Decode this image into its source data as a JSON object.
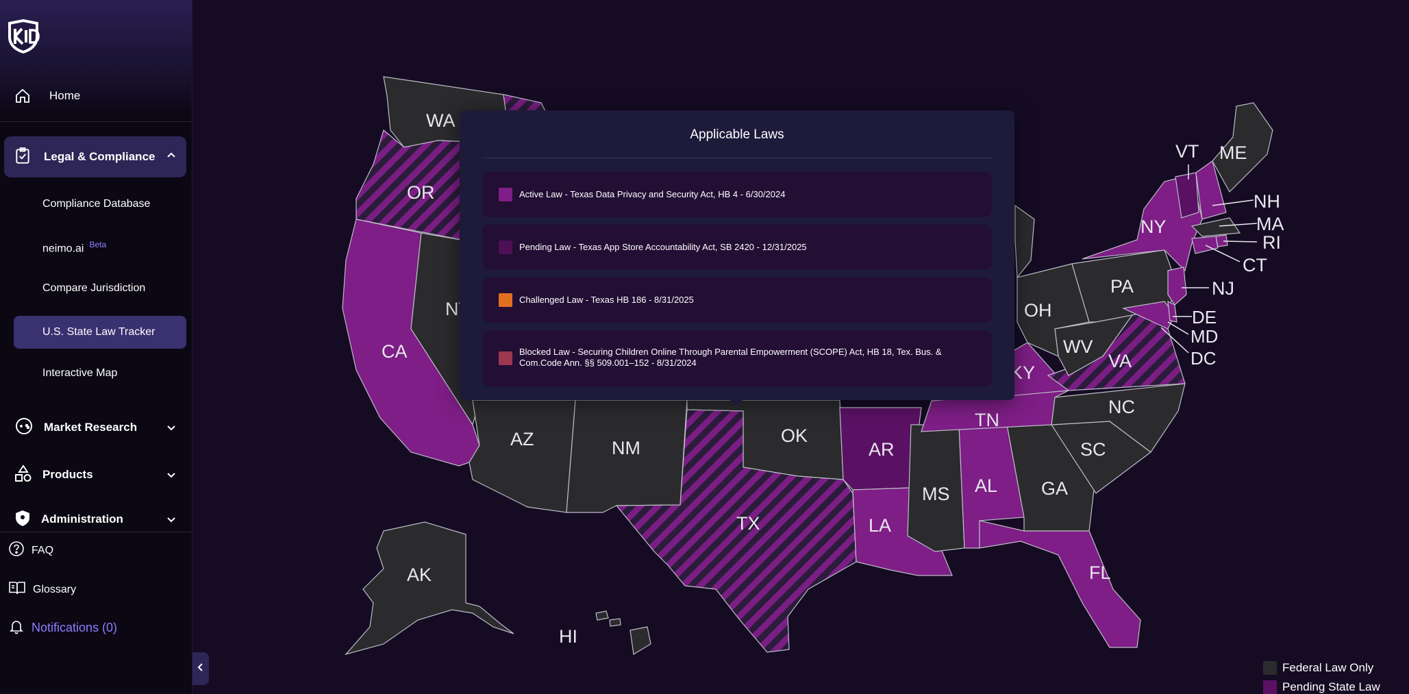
{
  "app": {
    "logo_text": "kID"
  },
  "sidebar": {
    "home": "Home",
    "legal": {
      "label": "Legal & Compliance",
      "items": [
        {
          "label": "Compliance Database"
        },
        {
          "label": "neimo.ai",
          "badge": "Beta"
        },
        {
          "label": "Compare Jurisdiction"
        },
        {
          "label": "U.S. State Law Tracker",
          "active": true
        },
        {
          "label": "Interactive Map"
        }
      ]
    },
    "sections": [
      {
        "label": "Market Research",
        "icon": "gamepad-icon"
      },
      {
        "label": "Products",
        "icon": "shapes-icon"
      },
      {
        "label": "Administration",
        "icon": "admin-icon"
      }
    ],
    "footer": {
      "faq": "FAQ",
      "glossary": "Glossary",
      "notifications": "Notifications (0)"
    }
  },
  "map": {
    "state_labels": [
      "WA",
      "OR",
      "CA",
      "NV",
      "AZ",
      "NM",
      "OK",
      "TX",
      "AR",
      "LA",
      "MS",
      "AL",
      "GA",
      "FL",
      "SC",
      "NC",
      "TN",
      "KY",
      "VA",
      "WV",
      "OH",
      "PA",
      "NY",
      "VT",
      "ME",
      "NH",
      "MA",
      "RI",
      "CT",
      "NJ",
      "DE",
      "MD",
      "DC",
      "AK",
      "HI"
    ],
    "status": {
      "WA": "federal",
      "OR": "challenged",
      "CA": "active",
      "NV": "federal",
      "AZ": "federal",
      "NM": "federal",
      "OK": "federal",
      "TX": "challenged",
      "AR": "pending",
      "LA": "active",
      "MS": "federal",
      "AL": "active",
      "GA": "federal",
      "FL": "active",
      "SC": "federal",
      "NC": "federal",
      "TN": "active",
      "KY": "active",
      "VA": "challenged",
      "WV": "federal",
      "OH": "federal",
      "PA": "federal",
      "NY": "active",
      "VT": "pending",
      "ME": "federal",
      "NH": "active",
      "MA": "federal",
      "RI": "active",
      "CT": "active",
      "NJ": "active",
      "DE": "active",
      "MD": "active",
      "DC": "active",
      "AK": "federal",
      "HI": "federal"
    },
    "colors": {
      "federal": "#2b2b2e",
      "active": "#7e1e86",
      "pending": "#5a1164",
      "challenged_stripe": "#2a1d3a"
    }
  },
  "popup": {
    "title": "Applicable Laws",
    "laws": [
      {
        "color": "#7e1e86",
        "text": "Active Law - Texas Data Privacy and Security Act, HB 4 - 6/30/2024"
      },
      {
        "color": "#4d0f55",
        "text": "Pending Law - Texas App Store Accountability Act, SB 2420 - 12/31/2025"
      },
      {
        "color": "#e07020",
        "text": "Challenged Law - Texas HB 186 - 8/31/2025"
      },
      {
        "color": "#9c3750",
        "text": "Blocked Law - Securing Children Online Through Parental Empowerment (SCOPE) Act, HB 18, Tex. Bus. & Com.Code Ann. §§ 509.001–152 - 8/31/2024"
      }
    ]
  },
  "legend": [
    {
      "label": "Federal Law Only",
      "color": "#2b2b2e"
    },
    {
      "label": "Pending State Law",
      "color": "#5a1164"
    }
  ]
}
